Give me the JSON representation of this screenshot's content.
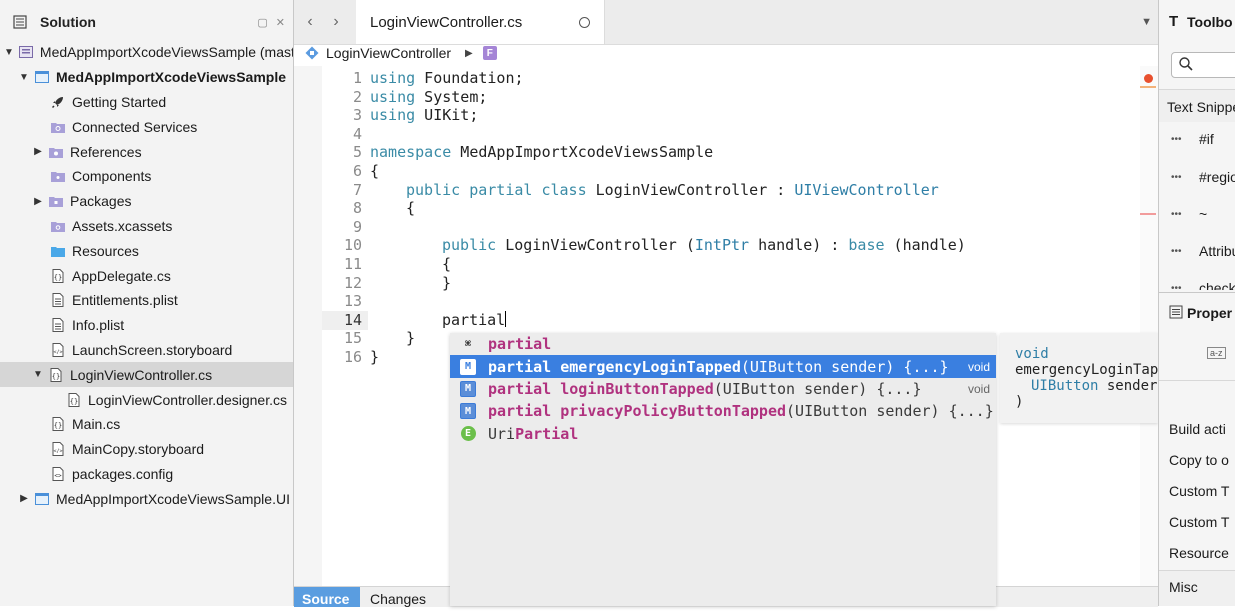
{
  "solution_pad": {
    "title": "Solution",
    "items": [
      {
        "label": "MedAppImportXcodeViewsSample (mast",
        "icon": "solution-icon"
      },
      {
        "label": "MedAppImportXcodeViewsSample",
        "icon": "project-icon"
      },
      {
        "label": "Getting Started",
        "icon": "rocket-icon"
      },
      {
        "label": "Connected Services",
        "icon": "connected-services-folder-icon"
      },
      {
        "label": "References",
        "icon": "references-folder-icon"
      },
      {
        "label": "Components",
        "icon": "components-folder-icon"
      },
      {
        "label": "Packages",
        "icon": "packages-folder-icon"
      },
      {
        "label": "Assets.xcassets",
        "icon": "assets-folder-icon"
      },
      {
        "label": "Resources",
        "icon": "folder-icon"
      },
      {
        "label": "AppDelegate.cs",
        "icon": "csharp-file-icon"
      },
      {
        "label": "Entitlements.plist",
        "icon": "plist-file-icon"
      },
      {
        "label": "Info.plist",
        "icon": "plist-file-icon"
      },
      {
        "label": "LaunchScreen.storyboard",
        "icon": "storyboard-file-icon"
      },
      {
        "label": "LoginViewController.cs",
        "icon": "csharp-file-icon"
      },
      {
        "label": "LoginViewController.designer.cs",
        "icon": "csharp-file-icon"
      },
      {
        "label": "Main.cs",
        "icon": "csharp-file-icon"
      },
      {
        "label": "MainCopy.storyboard",
        "icon": "storyboard-file-icon"
      },
      {
        "label": "packages.config",
        "icon": "config-file-icon"
      },
      {
        "label": "MedAppImportXcodeViewsSample.UI",
        "icon": "project-icon"
      }
    ]
  },
  "editor": {
    "tab_label": "LoginViewController.cs",
    "path_class": "LoginViewController",
    "path_member_badge": "F",
    "line_numbers": [
      "1",
      "2",
      "3",
      "4",
      "5",
      "6",
      "7",
      "8",
      "9",
      "10",
      "11",
      "12",
      "13",
      "14",
      "15",
      "16"
    ],
    "code": {
      "l1_kw": "using",
      "l1_rest": " Foundation;",
      "l2_kw": "using",
      "l2_rest": " System;",
      "l3_kw": "using",
      "l3_rest": " UIKit;",
      "l5_kw": "namespace",
      "l5_rest": " MedAppImportXcodeViewsSample",
      "l6": "{",
      "l7_kw1": "public",
      "l7_kw2": "partial",
      "l7_kw3": "class",
      "l7_name": "LoginViewController",
      "l7_colon": " : ",
      "l7_base": "UIViewController",
      "l8": "{",
      "l10_kw": "public",
      "l10_name": " LoginViewController (",
      "l10_type": "IntPtr",
      "l10_mid": " handle) : ",
      "l10_base": "base",
      "l10_end": " (handle)",
      "l11": "{",
      "l12": "}",
      "l14": "partial",
      "l15": "}",
      "l16": "}"
    },
    "bottom_tabs": [
      "Source",
      "Changes"
    ]
  },
  "completion": {
    "items": [
      {
        "icon": "command-icon",
        "highlight": "partial",
        "rest": "",
        "type": ""
      },
      {
        "icon": "method-icon",
        "highlight": "partial emergencyLoginTapped",
        "rest": "(UIButton sender) {...}",
        "type": "void"
      },
      {
        "icon": "method-icon",
        "highlight": "partial loginButtonTapped",
        "rest": "(UIButton sender) {...}",
        "type": "void"
      },
      {
        "icon": "method-icon",
        "highlight": "partial privacyPolicyButtonTapped",
        "rest": "(UIButton sender) {...}",
        "type": ""
      },
      {
        "icon": "enum-icon",
        "prefix": "Uri",
        "highlight": "Partial",
        "rest": "",
        "type": ""
      }
    ],
    "method_badge": "M",
    "enum_badge": "E",
    "command_glyph": "⌘"
  },
  "tooltip": {
    "line1": "void",
    "line2": "emergencyLoginTapped(",
    "line3_type": "UIButton",
    "line3_rest": " sender",
    "line4": ")"
  },
  "right_pane": {
    "toolbox_title": "Toolbo",
    "text_snippets_label": "Text Snippe",
    "snippets": [
      "#if",
      "#regio",
      "~",
      "Attribu",
      "check"
    ],
    "properties_title": "Proper",
    "property_rows": [
      "Build acti",
      "Copy to o",
      "Custom T",
      "Custom T",
      "Resource",
      "Misc"
    ]
  },
  "colors": {
    "keyword": "#3a8ba6",
    "partial_keyword": "#b0327f",
    "selection": "#3a7fe0",
    "source_tab": "#5a9de0"
  }
}
